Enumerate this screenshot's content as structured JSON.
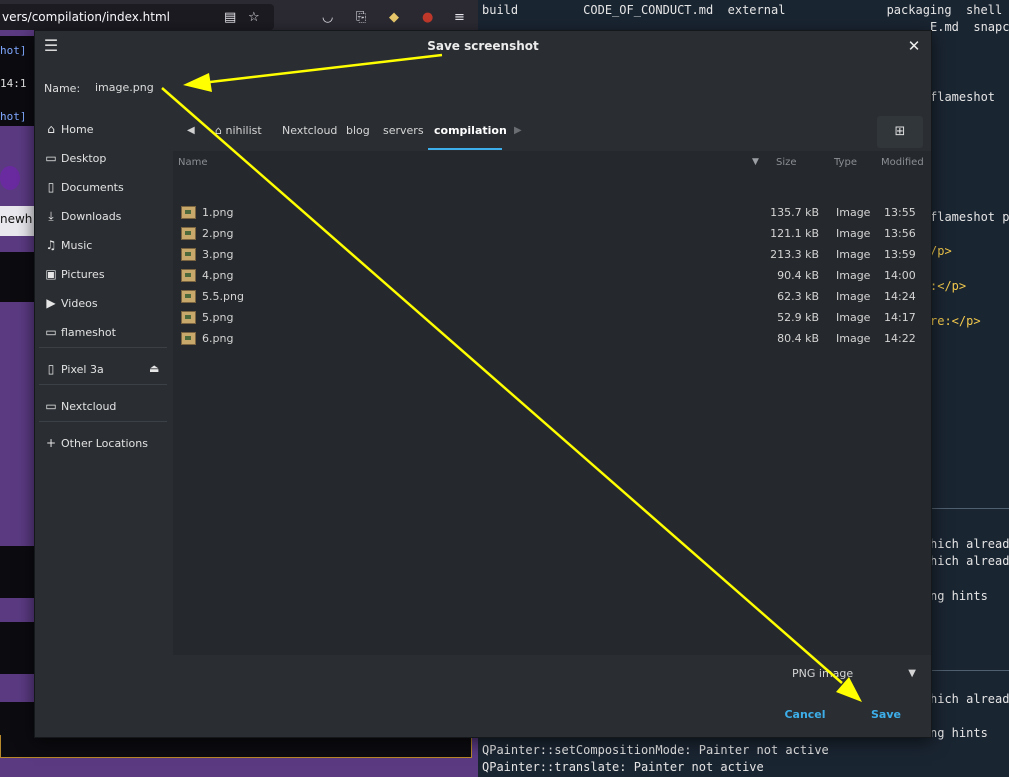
{
  "browser": {
    "url": "vers/compilation/index.html",
    "toolbar_icons": [
      "reader-icon",
      "bookmark-star-icon",
      "pocket-icon",
      "share-icon",
      "extension-icon",
      "ublock-icon",
      "menu-icon"
    ],
    "left_texts": [
      "hot]",
      "14:1",
      "hot]",
      "newh"
    ]
  },
  "terminal": {
    "top_line_1": "build         CODE_OF_CONDUCT.md  external              packaging  shell",
    "top_line_2_partial": "E.md  snapc",
    "right_fragments": [
      "flameshot",
      "flameshot p",
      "/p>",
      ":</p>",
      "re:</p>",
      "hich alread",
      "hich alread",
      "ng hints",
      "hich alread",
      "ng hints"
    ],
    "bottom_lines": [
      "QPainter::setCompositionMode: Painter not active",
      "QPainter::translate: Painter not active"
    ]
  },
  "dialog": {
    "title": "Save screenshot",
    "name_label": "Name:",
    "name_value": "image.png",
    "sidebar": {
      "items": [
        {
          "label": "Home",
          "icon": "home-icon"
        },
        {
          "label": "Desktop",
          "icon": "folder-icon"
        },
        {
          "label": "Documents",
          "icon": "document-icon"
        },
        {
          "label": "Downloads",
          "icon": "download-icon"
        },
        {
          "label": "Music",
          "icon": "music-icon"
        },
        {
          "label": "Pictures",
          "icon": "picture-icon"
        },
        {
          "label": "Videos",
          "icon": "video-icon"
        },
        {
          "label": "flameshot",
          "icon": "folder-icon"
        }
      ],
      "device": {
        "label": "Pixel 3a",
        "icon": "phone-icon"
      },
      "network": {
        "label": "Nextcloud",
        "icon": "folder-icon"
      },
      "other": {
        "label": "Other Locations",
        "icon": "plus-icon"
      }
    },
    "breadcrumbs": [
      "nihilist",
      "Nextcloud",
      "blog",
      "servers",
      "compilation"
    ],
    "columns": {
      "name": "Name",
      "size": "Size",
      "type": "Type",
      "modified": "Modified"
    },
    "files": [
      {
        "name": "1.png",
        "size": "135.7 kB",
        "type": "Image",
        "modified": "13:55"
      },
      {
        "name": "2.png",
        "size": "121.1 kB",
        "type": "Image",
        "modified": "13:56"
      },
      {
        "name": "3.png",
        "size": "213.3 kB",
        "type": "Image",
        "modified": "13:59"
      },
      {
        "name": "4.png",
        "size": "90.4 kB",
        "type": "Image",
        "modified": "14:00"
      },
      {
        "name": "5.5.png",
        "size": "62.3 kB",
        "type": "Image",
        "modified": "14:24"
      },
      {
        "name": "5.png",
        "size": "52.9 kB",
        "type": "Image",
        "modified": "14:17"
      },
      {
        "name": "6.png",
        "size": "80.4 kB",
        "type": "Image",
        "modified": "14:22"
      }
    ],
    "filter": "PNG image",
    "cancel_label": "Cancel",
    "save_label": "Save"
  },
  "annotation": {
    "arrow_color": "#ffff00"
  },
  "colors": {
    "accent": "#3daee9",
    "dialog_bg": "#2a2e33",
    "list_bg": "#25282c"
  }
}
